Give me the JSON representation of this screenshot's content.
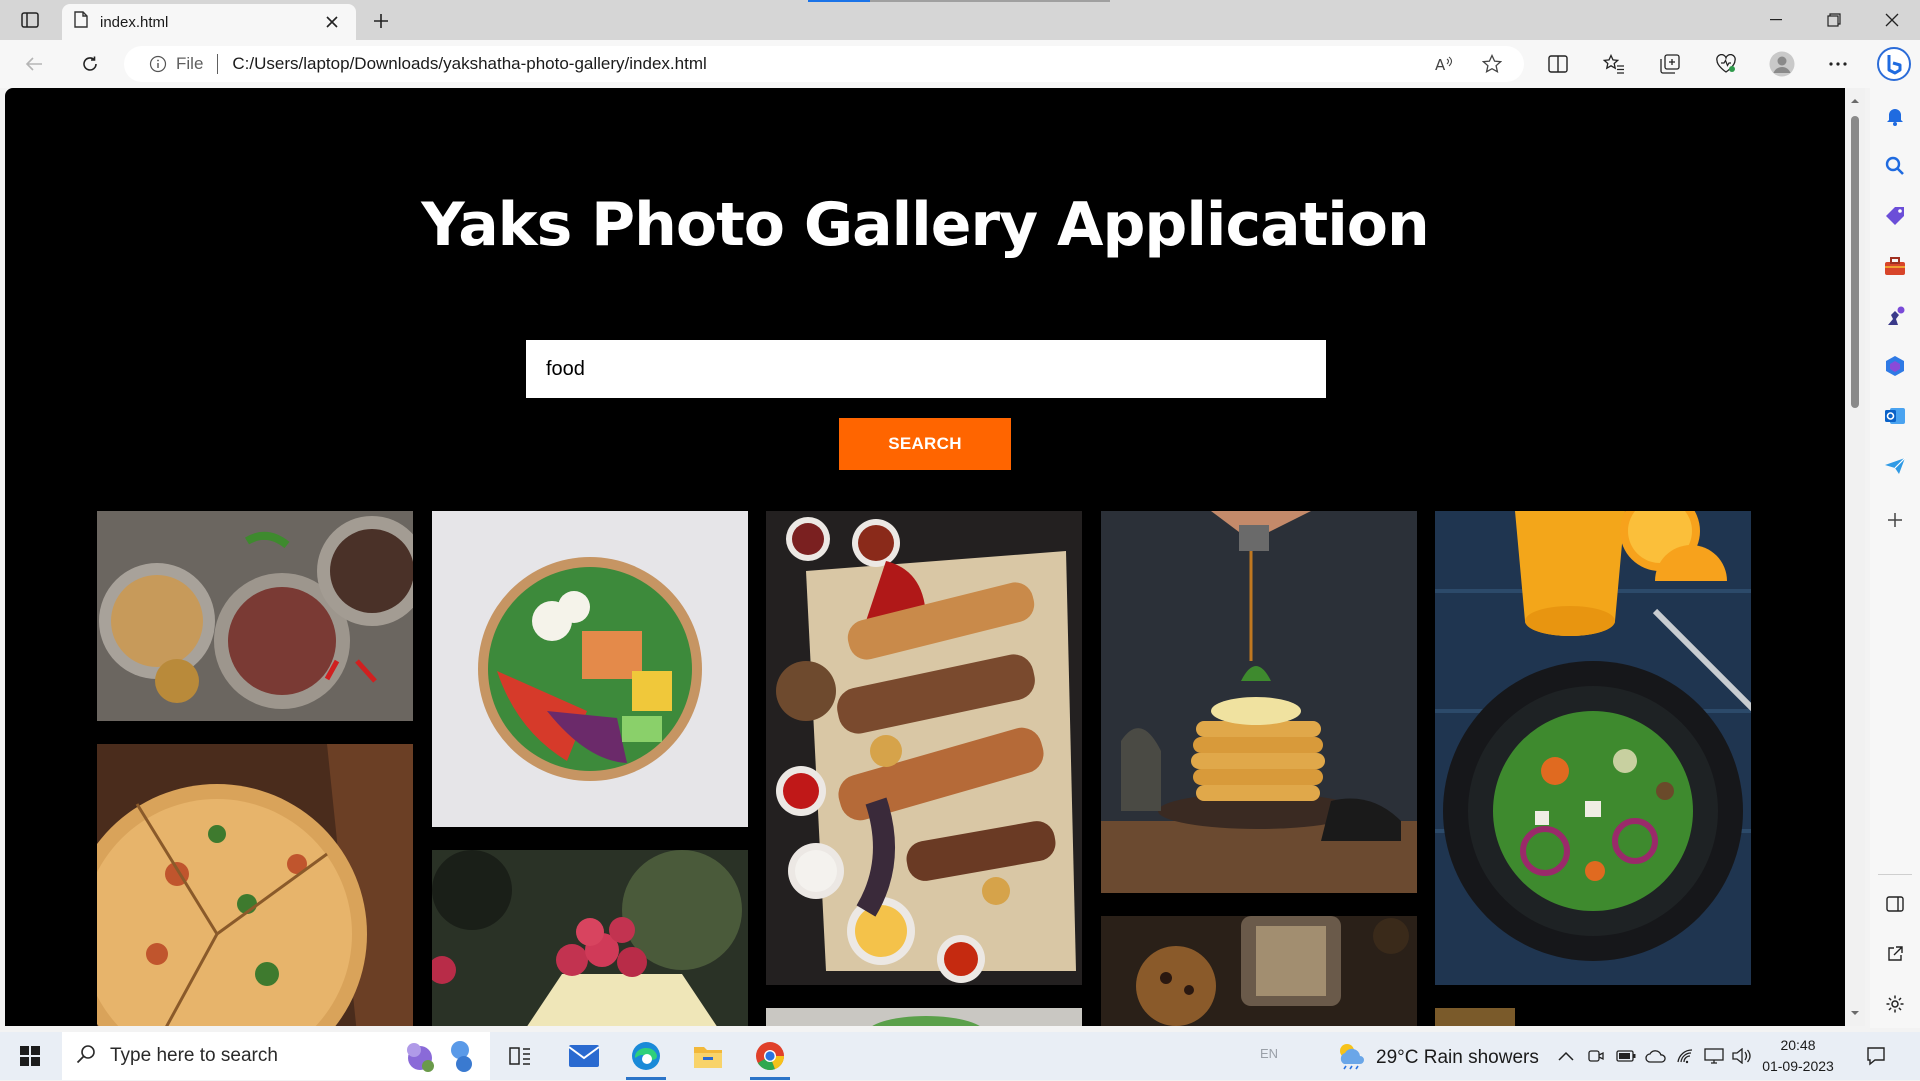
{
  "browser": {
    "tab_title": "index.html",
    "address_scheme": "File",
    "address_url": "C:/Users/laptop/Downloads/yakshatha-photo-gallery/index.html"
  },
  "page": {
    "title": "Yaks Photo Gallery Application",
    "search_value": "food",
    "search_button": "SEARCH"
  },
  "gallery": {
    "photos": [
      {
        "label": "grilled-dishes-platter",
        "palette": [
          "#6b6660",
          "#3d3a36"
        ]
      },
      {
        "label": "salad-bowl",
        "palette": [
          "#e7e6e8",
          "#d2d1d3"
        ]
      },
      {
        "label": "grilled-meat-platter",
        "palette": [
          "#5b4a3a",
          "#2a2420"
        ]
      },
      {
        "label": "pancakes-syrup",
        "palette": [
          "#3a4048",
          "#1e2228"
        ]
      },
      {
        "label": "salad-orange-juice",
        "palette": [
          "#2c4660",
          "#15222f"
        ]
      },
      {
        "label": "pizza",
        "palette": [
          "#6b3f25",
          "#3a2417"
        ]
      },
      {
        "label": "raspberry-dessert",
        "palette": [
          "#4e5a48",
          "#232a22"
        ]
      },
      {
        "label": "salad-partial",
        "palette": [
          "#c9c7c2",
          "#9e9c98"
        ]
      },
      {
        "label": "muffin-lantern",
        "palette": [
          "#4a3a2a",
          "#241c14"
        ]
      },
      {
        "label": "drink-partial",
        "palette": [
          "#7a5a2a",
          "#3a2a14"
        ]
      }
    ]
  },
  "taskbar": {
    "search_placeholder": "Type here to search",
    "language": "EN",
    "weather": "29°C  Rain showers",
    "time": "20:48",
    "date": "01-09-2023"
  },
  "colors": {
    "accent": "#ff6500",
    "page_bg": "#000000",
    "browser_bg": "#f7f7f7"
  }
}
